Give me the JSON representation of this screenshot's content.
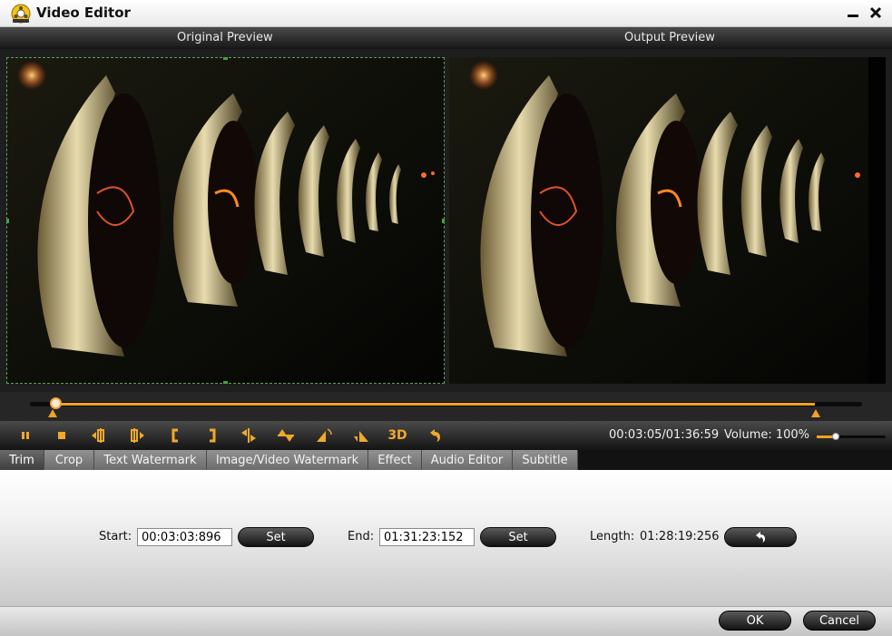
{
  "window": {
    "title": "Video Editor",
    "icon": "film-reel-icon",
    "minimize_icon": "minimize-icon",
    "close_icon": "close-icon"
  },
  "preview": {
    "original_label": "Original Preview",
    "output_label": "Output Preview"
  },
  "timeline": {
    "playhead_fraction": 0.03,
    "trim_start_fraction": 0.03,
    "trim_end_fraction": 0.94
  },
  "toolbar": {
    "buttons": [
      {
        "name": "pause",
        "icon": "pause-icon"
      },
      {
        "name": "stop",
        "icon": "stop-icon"
      },
      {
        "name": "previous-frame",
        "icon": "step-back-icon"
      },
      {
        "name": "next-frame",
        "icon": "step-forward-icon"
      },
      {
        "name": "set-start",
        "icon": "bracket-left-icon"
      },
      {
        "name": "set-end",
        "icon": "bracket-right-icon"
      },
      {
        "name": "flip-horizontal",
        "icon": "flip-horizontal-icon"
      },
      {
        "name": "flip-vertical",
        "icon": "flip-vertical-icon"
      },
      {
        "name": "rotate-left",
        "icon": "rotate-left-icon"
      },
      {
        "name": "rotate-right",
        "icon": "rotate-right-icon"
      },
      {
        "name": "3d",
        "icon": "3d-icon"
      },
      {
        "name": "undo",
        "icon": "undo-icon"
      }
    ],
    "three_d_label": "3D",
    "time_readout": "00:03:05/01:36:59",
    "volume_label": "Volume:  100%",
    "volume_level": 0.27
  },
  "tabs": [
    {
      "label": "Trim",
      "active": true
    },
    {
      "label": "Crop",
      "active": false
    },
    {
      "label": "Text Watermark",
      "active": false
    },
    {
      "label": "Image/Video Watermark",
      "active": false
    },
    {
      "label": "Effect",
      "active": false
    },
    {
      "label": "Audio Editor",
      "active": false
    },
    {
      "label": "Subtitle",
      "active": false
    }
  ],
  "trim": {
    "start_label": "Start:",
    "start_value": "00:03:03:896",
    "start_set_label": "Set",
    "end_label": "End:",
    "end_value": "01:31:23:152",
    "end_set_label": "Set",
    "length_label": "Length:",
    "length_value": "01:28:19:256",
    "reset_icon": "reset-icon"
  },
  "footer": {
    "ok_label": "OK",
    "cancel_label": "Cancel"
  },
  "colors": {
    "accent": "#f2a122",
    "crop_border": "#5aa05a"
  }
}
